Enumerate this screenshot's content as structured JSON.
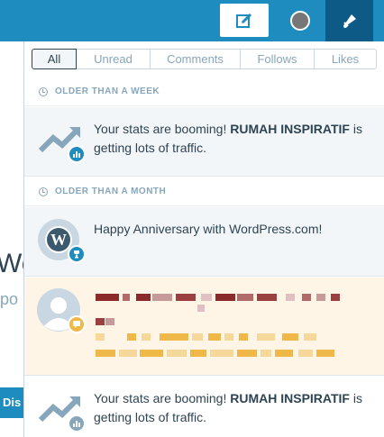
{
  "topbar": {
    "write_icon": "write-post-icon",
    "avatar_icon": "user-avatar",
    "notifications_icon": "bell-icon"
  },
  "background": {
    "heading_fragment": "We",
    "subtext_fragment": "po",
    "button_fragment": "Dis"
  },
  "filters": [
    {
      "label": "All",
      "active": true
    },
    {
      "label": "Unread",
      "active": false
    },
    {
      "label": "Comments",
      "active": false
    },
    {
      "label": "Follows",
      "active": false
    },
    {
      "label": "Likes",
      "active": false
    }
  ],
  "sections": {
    "week": "OLDER THAN A WEEK",
    "month": "OLDER THAN A MONTH"
  },
  "notes": {
    "stats1": {
      "lead": "Your stats are booming! ",
      "site": "RUMAH INSPIRATIF",
      "tail": " is getting lots of traffic.",
      "icon": "trending-up-icon",
      "badge": "stats-icon"
    },
    "anniversary": {
      "text": "Happy Anniversary with WordPress.com!",
      "icon": "wordpress-logo-icon",
      "badge": "trophy-icon"
    },
    "comment": {
      "icon": "default-avatar-icon",
      "badge": "comment-icon"
    },
    "stats2": {
      "lead": "Your stats are booming! ",
      "site": "RUMAH INSPIRATIF",
      "tail": " is getting lots of traffic.",
      "icon": "trending-up-icon",
      "badge": "stats-icon"
    }
  },
  "colors": {
    "accent": "#1e8cbe",
    "badge_stats": "#1e8cbe",
    "badge_comment": "#f0b849",
    "badge_read": "#87a6bc",
    "unread_bg": "#fef5e7"
  }
}
